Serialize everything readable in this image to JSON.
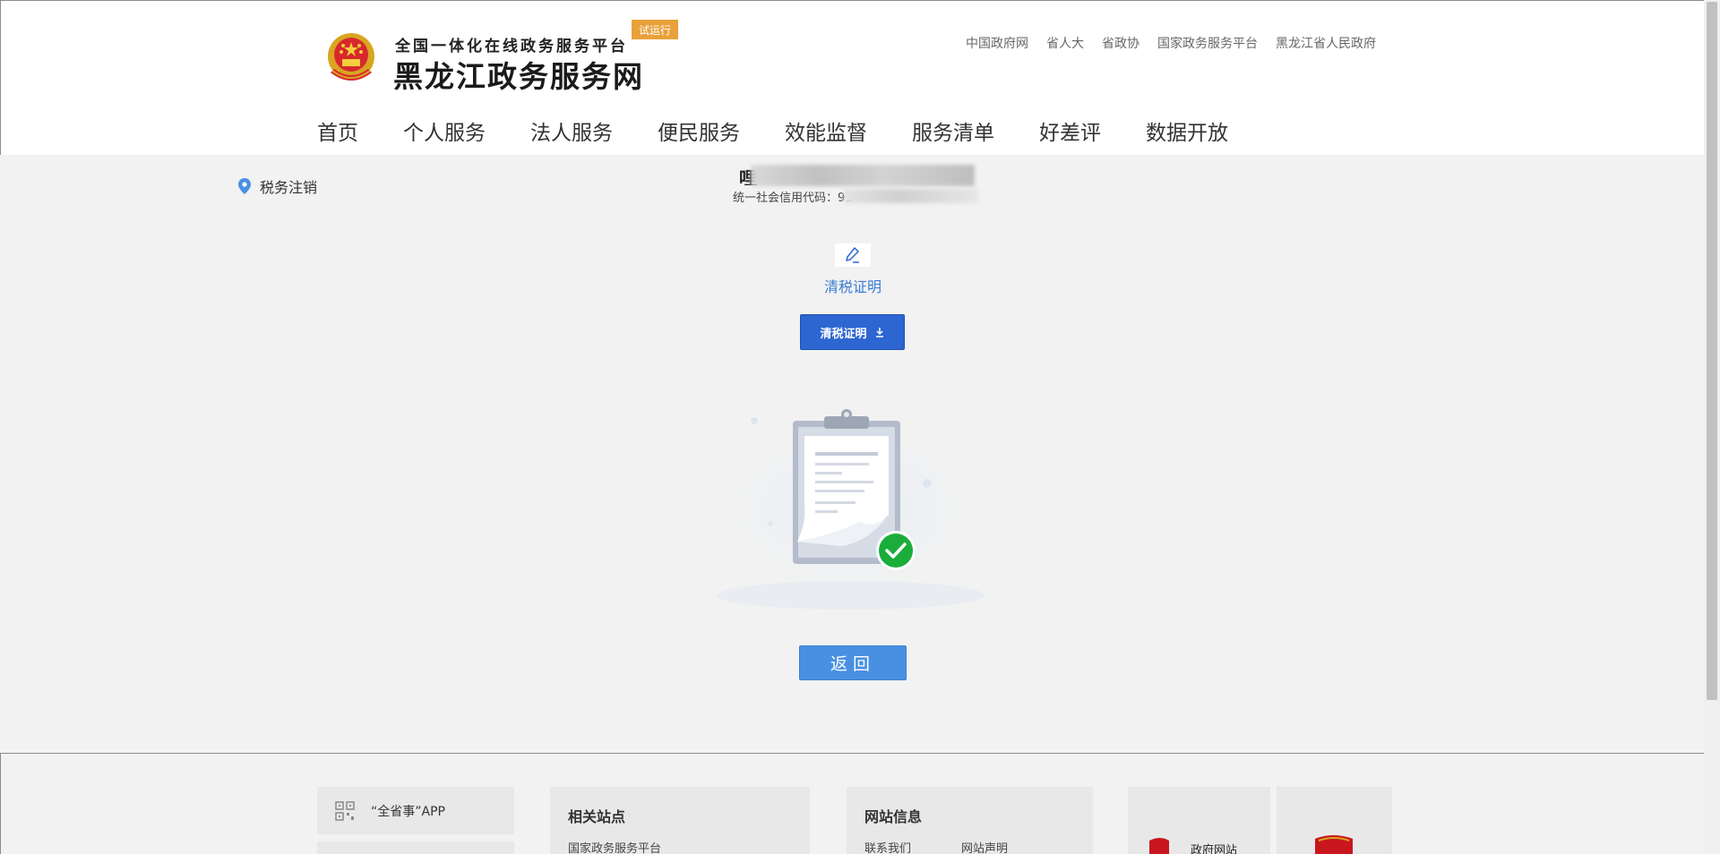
{
  "header": {
    "logo_subtitle": "全国一体化在线政务服务平台",
    "logo_title": "黑龙江政务服务网",
    "trial_badge": "试运行",
    "top_links": [
      "中国政府网",
      "省人大",
      "省政协",
      "国家政务服务平台",
      "黑龙江省人民政府"
    ],
    "nav": [
      "首页",
      "个人服务",
      "法人服务",
      "便民服务",
      "效能监督",
      "服务清单",
      "好差评",
      "数据开放"
    ]
  },
  "main": {
    "location_icon": "map-pin-icon",
    "location_label": "税务注销",
    "company_name_visible": "哩",
    "credit_code_label": "统一社会信用代码：91",
    "certificate_icon": "pen-edit-icon",
    "certificate_link": "清税证明",
    "download_button": "清税证明",
    "download_icon": "download-icon",
    "back_button": "返回",
    "colors": {
      "primary": "#2d66d1",
      "link": "#3a7bd5",
      "back": "#4a90e2",
      "badge": "#e9a13a",
      "success": "#1aad3a"
    }
  },
  "footer": {
    "app_label": "“全省事”APP",
    "app_icon": "qr-code-icon",
    "related_title": "相关站点",
    "related_links": [
      "国家政务服务平台"
    ],
    "site_info_title": "网站信息",
    "site_info_links": [
      "联系我们",
      "网站声明"
    ],
    "gov_badge_label": "政府网站"
  }
}
